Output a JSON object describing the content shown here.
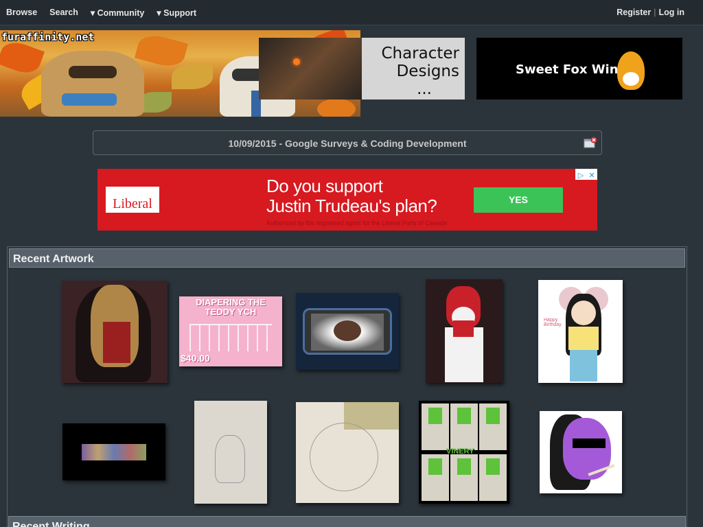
{
  "topnav": {
    "browse": "Browse",
    "search": "Search",
    "community": "▾ Community",
    "support": "▾ Support",
    "register": "Register",
    "separator": "|",
    "login": "Log in"
  },
  "banner": {
    "site_name": "furaffinity.net"
  },
  "ads": {
    "character_designs": [
      "Character",
      "Designs",
      "..."
    ],
    "sweet_fox": "Sweet Fox Wings",
    "liberal": {
      "logo": "Liberal",
      "line1": "Do you support",
      "line2": "Justin Trudeau's plan?",
      "button": "YES",
      "authorized": "Authorized by the registered agent for the Liberal Party of Canada"
    }
  },
  "notice": {
    "title": "10/09/2015 - Google Surveys & Coding Development"
  },
  "recent_artwork": {
    "title": "Recent Artwork",
    "thumb_texts": {
      "teddy_title": "DIAPERING THE TEDDY YCH",
      "teddy_price": "$40.00",
      "birthday": "Happy Birthday",
      "vinery": "VINERY"
    }
  },
  "recent_writing": {
    "title": "Recent Writing"
  }
}
